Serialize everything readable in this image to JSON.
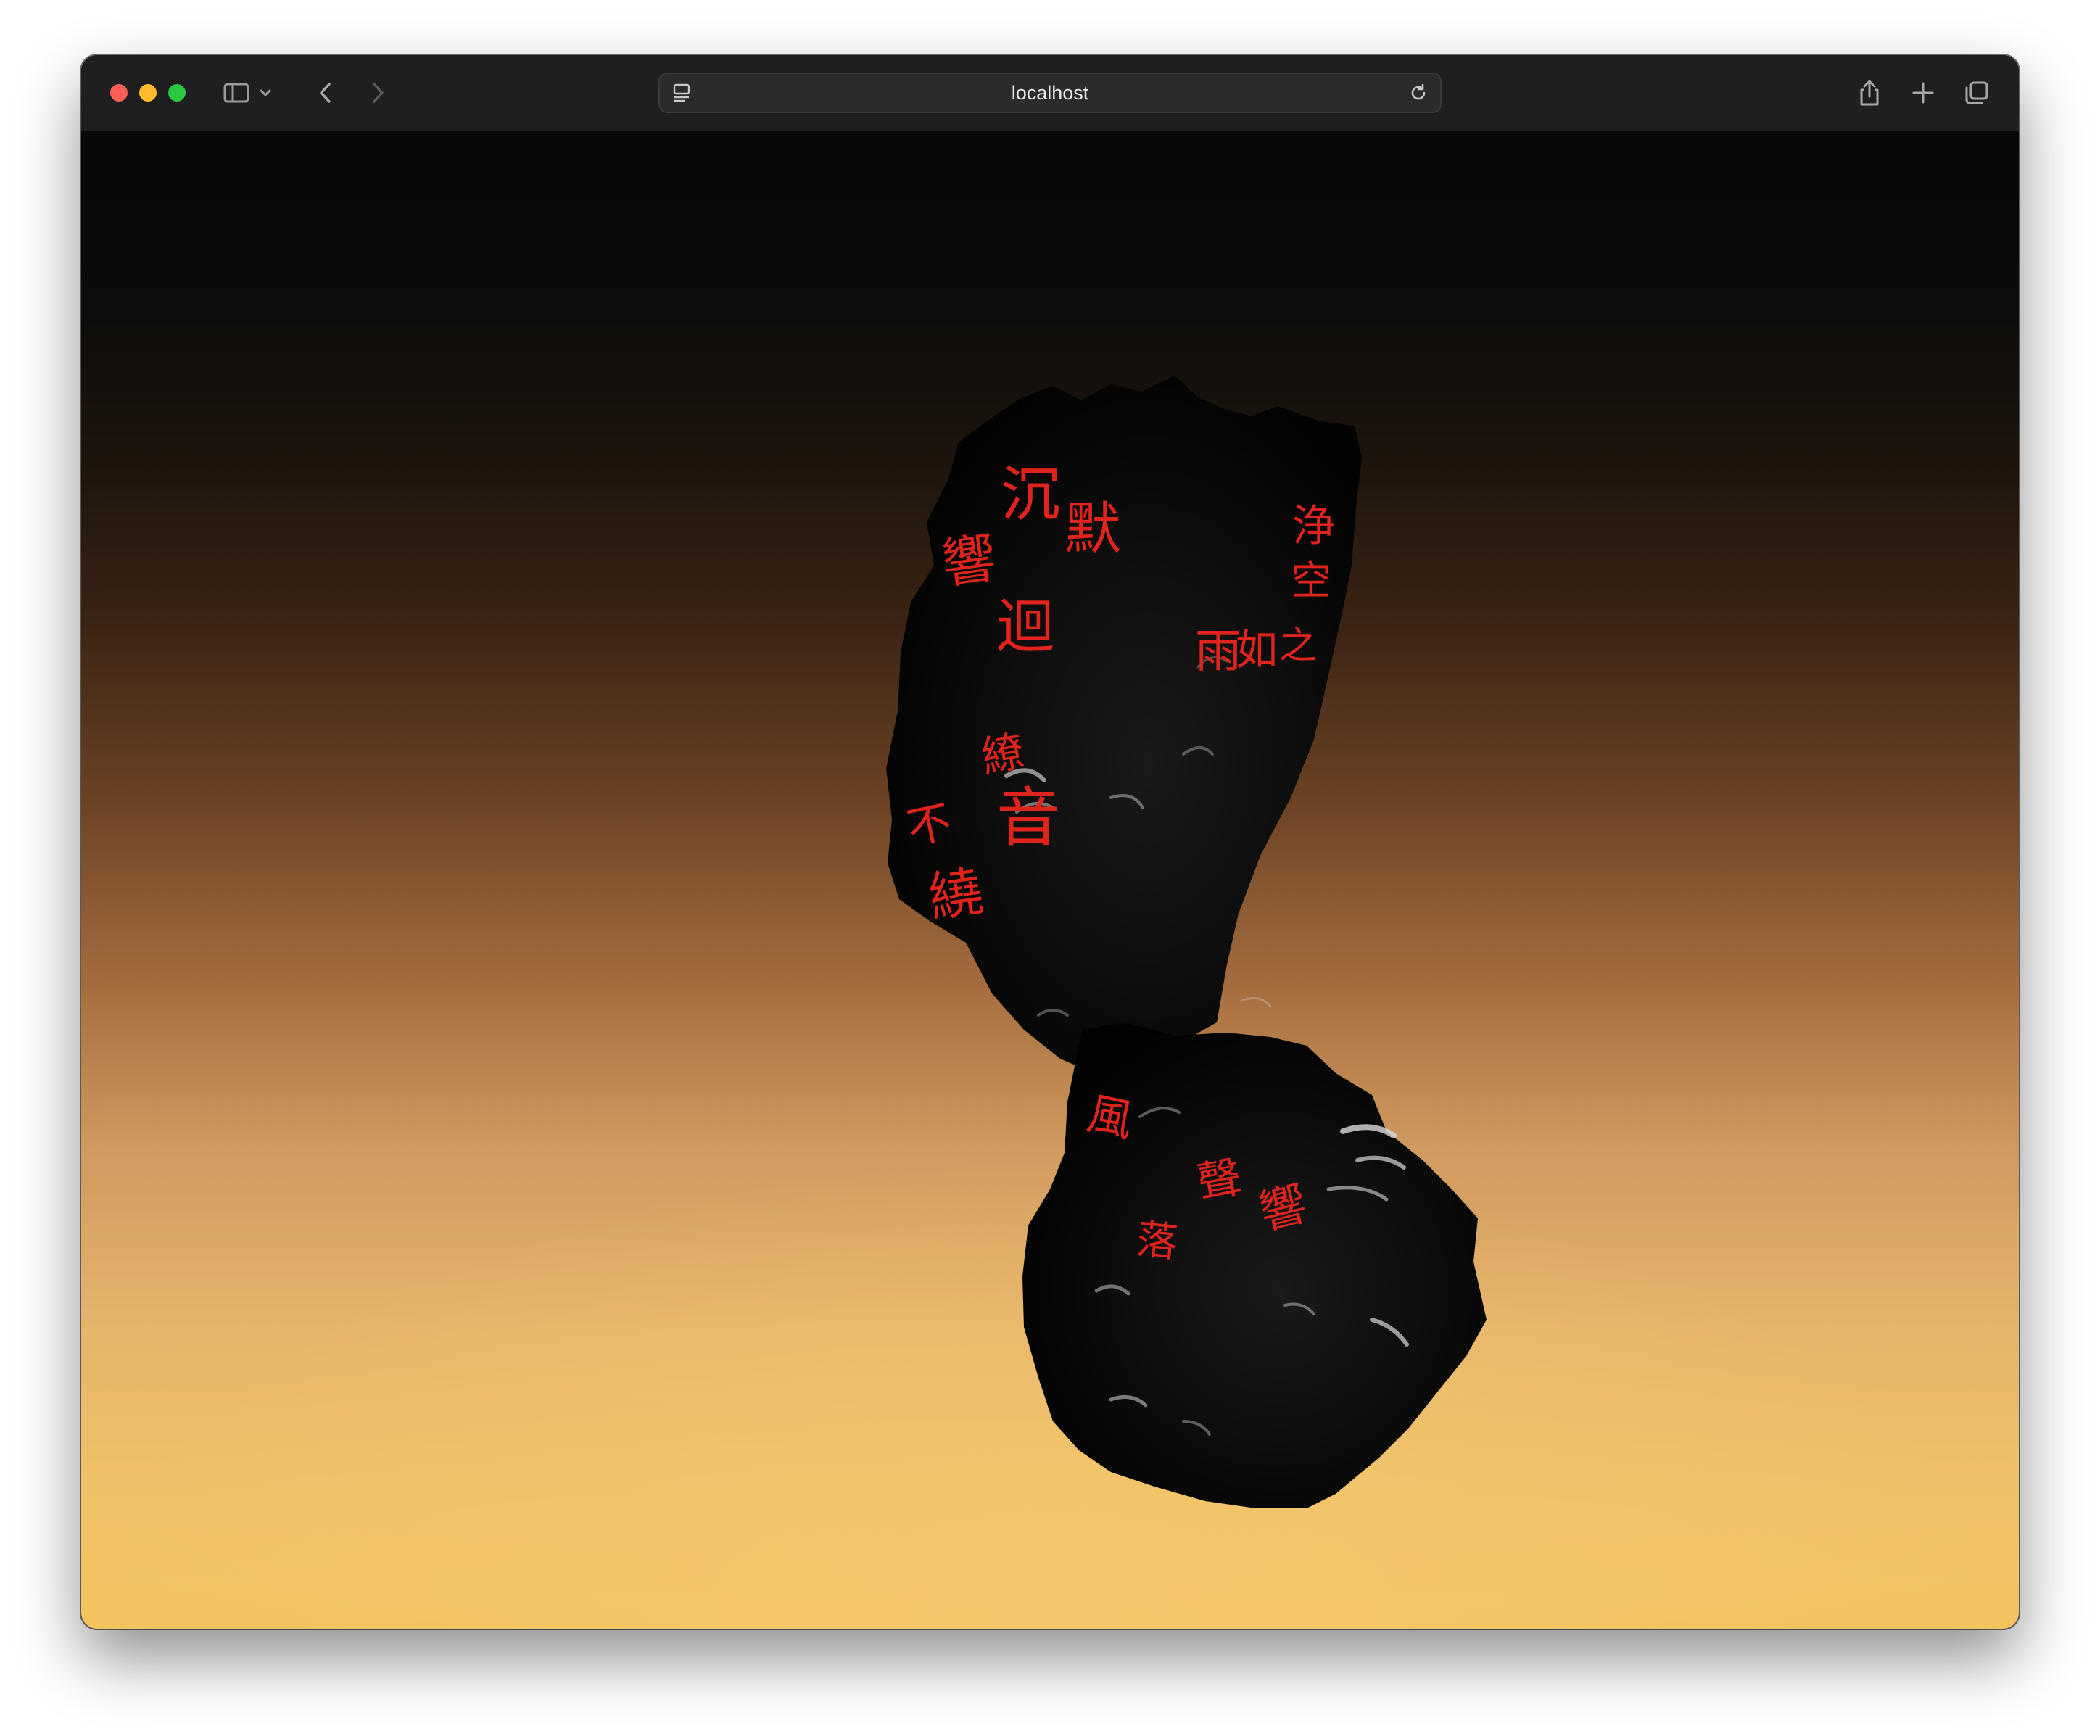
{
  "browser": {
    "url": "localhost",
    "icons": {
      "close": "close-dot",
      "minimize": "minimize-dot",
      "maximize": "maximize-dot",
      "sidebar": "sidebar-icon",
      "sidebar_menu": "chevron-down-icon",
      "back": "back-arrow-icon",
      "forward": "forward-arrow-icon",
      "page_settings": "page-settings-icon",
      "reload": "reload-icon",
      "share": "share-icon",
      "new_tab": "plus-icon",
      "tab_overview": "tab-overview-icon"
    }
  },
  "scene": {
    "background_colors": [
      "#070808",
      "#3b2414",
      "#a56d3f",
      "#e6b56c",
      "#f2c45e"
    ],
    "rock_color": "#050505",
    "glyph_color": "#e0231c",
    "glyphs": {
      "g1": "沉",
      "g2": "默",
      "g3": "響",
      "g4": "迴",
      "g5": "浄",
      "g6": "空",
      "g7": "之",
      "g8": "雨",
      "g9": "如",
      "g10": "繚",
      "g11": "音",
      "g12": "不",
      "g13": "繞",
      "g14": "風",
      "g15": "聲",
      "g16": "落",
      "g17": "響"
    }
  }
}
